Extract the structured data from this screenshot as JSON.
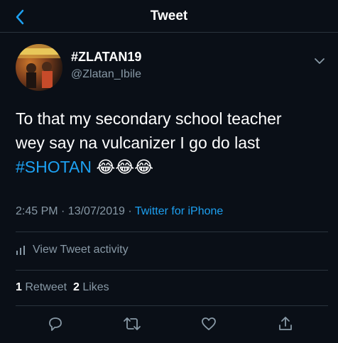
{
  "header": {
    "title": "Tweet"
  },
  "tweet": {
    "display_name": "#ZLATAN19",
    "handle": "@Zlatan_Ibile",
    "text_line1": "To that my secondary school teacher",
    "text_line2": "wey say na vulcanizer I go do last",
    "hashtag": "#SHOTAN",
    "emoji": "😂😂😂",
    "time": "2:45 PM · 13/07/2019 · ",
    "source": "Twitter for iPhone"
  },
  "activity": {
    "label": "View Tweet activity"
  },
  "stats": {
    "retweets_count": "1",
    "retweets_label": "Retweet",
    "likes_count": "2",
    "likes_label": "Likes"
  },
  "colors": {
    "accent": "#1da1f2",
    "background": "#0a0f17",
    "muted": "#8899a6"
  },
  "icons": [
    "back-chevron-icon",
    "chevron-down-icon",
    "bar-chart-icon",
    "reply-icon",
    "retweet-icon",
    "like-icon",
    "share-icon"
  ]
}
